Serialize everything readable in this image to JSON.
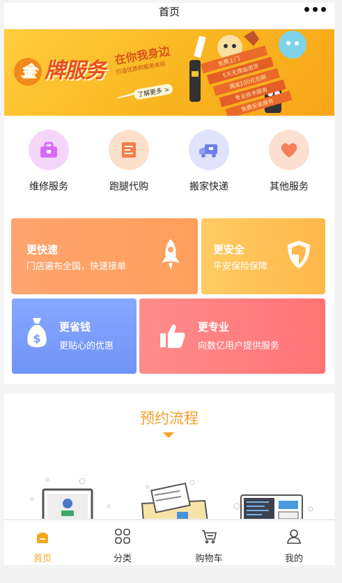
{
  "nav": {
    "title": "首页"
  },
  "banner": {
    "brand_mark": "金",
    "brand_text": "牌服务",
    "slogan": "在你我身边",
    "subtitle": "打造优质的服务体验",
    "learn_more": "了解更多 >",
    "ribbon_lines": [
      "免费上门",
      "5天无理由退货",
      "满减100元包邮",
      "专业技术服务",
      "免费安装服务"
    ]
  },
  "services": [
    {
      "label": "维修服务",
      "icon": "toolbox-icon",
      "color": "#d66cf6",
      "bg": "#f4d6fb"
    },
    {
      "label": "跑腿代购",
      "icon": "receipt-icon",
      "color": "#f57e49",
      "bg": "#fde0cc"
    },
    {
      "label": "搬家快递",
      "icon": "truck-icon",
      "color": "#6e7fe8",
      "bg": "#dfe3fb"
    },
    {
      "label": "其他服务",
      "icon": "heart-icon",
      "color": "#f67f5a",
      "bg": "#fde0d2"
    }
  ],
  "features": [
    {
      "title": "更快速",
      "desc": "门店遍布全国，快速接单",
      "icon": "rocket-icon"
    },
    {
      "title": "更安全",
      "desc": "平安保险保障",
      "icon": "shield-icon"
    },
    {
      "title": "更省钱",
      "desc": "更贴心的优惠",
      "icon": "money-bag-icon"
    },
    {
      "title": "更专业",
      "desc": "向数亿用户提供服务",
      "icon": "thumbs-up-icon"
    }
  ],
  "process": {
    "title": "预约流程"
  },
  "tabs": [
    {
      "label": "首页",
      "icon": "home-icon",
      "active": true
    },
    {
      "label": "分类",
      "icon": "grid-icon",
      "active": false
    },
    {
      "label": "购物车",
      "icon": "cart-icon",
      "active": false
    },
    {
      "label": "我的",
      "icon": "user-icon",
      "active": false
    }
  ],
  "colors": {
    "accent": "#f5a623",
    "process_title": "#f59f2c"
  }
}
